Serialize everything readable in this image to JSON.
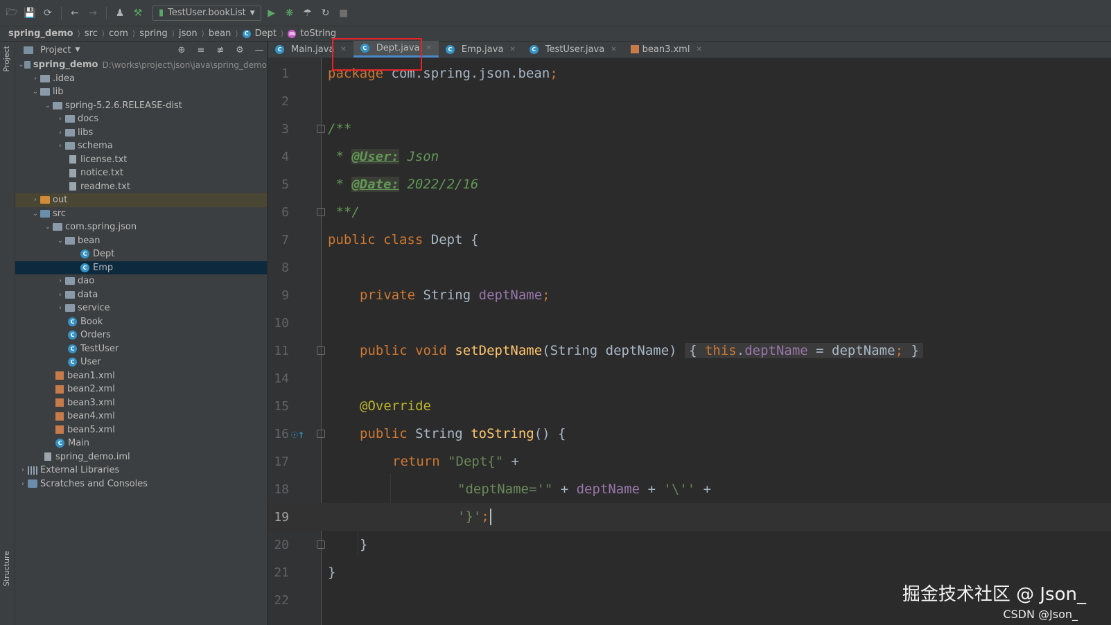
{
  "toolbar": {
    "run_config": "TestUser.bookList"
  },
  "breadcrumb": [
    "spring_demo",
    "src",
    "com",
    "spring",
    "json",
    "bean",
    "Dept",
    "toString"
  ],
  "side_stripe": {
    "project_label": "Project",
    "structure_label": "Structure"
  },
  "project_panel": {
    "title": "Project",
    "tree": [
      {
        "label": "spring_demo",
        "hint": "D:\\works\\project\\json\\java\\spring_demo"
      },
      {
        "label": ".idea"
      },
      {
        "label": "lib"
      },
      {
        "label": "spring-5.2.6.RELEASE-dist"
      },
      {
        "label": "docs"
      },
      {
        "label": "libs"
      },
      {
        "label": "schema"
      },
      {
        "label": "license.txt"
      },
      {
        "label": "notice.txt"
      },
      {
        "label": "readme.txt"
      },
      {
        "label": "out"
      },
      {
        "label": "src"
      },
      {
        "label": "com.spring.json"
      },
      {
        "label": "bean"
      },
      {
        "label": "Dept"
      },
      {
        "label": "Emp"
      },
      {
        "label": "dao"
      },
      {
        "label": "data"
      },
      {
        "label": "service"
      },
      {
        "label": "Book"
      },
      {
        "label": "Orders"
      },
      {
        "label": "TestUser"
      },
      {
        "label": "User"
      },
      {
        "label": "bean1.xml"
      },
      {
        "label": "bean2.xml"
      },
      {
        "label": "bean3.xml"
      },
      {
        "label": "bean4.xml"
      },
      {
        "label": "bean5.xml"
      },
      {
        "label": "Main"
      },
      {
        "label": "spring_demo.iml"
      },
      {
        "label": "External Libraries"
      },
      {
        "label": "Scratches and Consoles"
      }
    ]
  },
  "tabs": [
    {
      "label": "Main.java"
    },
    {
      "label": "Dept.java"
    },
    {
      "label": "Emp.java"
    },
    {
      "label": "TestUser.java"
    },
    {
      "label": "bean3.xml"
    }
  ],
  "editor": {
    "line_numbers": [
      "1",
      "2",
      "3",
      "4",
      "5",
      "6",
      "7",
      "8",
      "9",
      "10",
      "11",
      "14",
      "15",
      "16",
      "17",
      "18",
      "19",
      "20",
      "21",
      "22"
    ],
    "current_line": "19",
    "tokens": {
      "package_kw": "package",
      "package_name": "com.spring.json.bean",
      "semicolon": ";",
      "doc_open": "/**",
      "doc_star": " * ",
      "tag_user": "@User:",
      "user_val": " Json",
      "tag_date": "@Date:",
      "date_val": " 2022/2/16",
      "doc_close": " **/",
      "public": "public",
      "class": "class",
      "class_name": "Dept",
      "open_brace": "{",
      "close_brace": "}",
      "private": "private",
      "string_type": "String",
      "field": "deptName",
      "void": "void",
      "setter": "setDeptName",
      "setter_params": "(String deptName)",
      "this": "this",
      "eq": " = ",
      "param": "deptName",
      "annotation": "@Override",
      "tostring": "toString",
      "parens": "()",
      "return": "return",
      "str_open": "\"Dept{\"",
      "plus": " + ",
      "str_field": "\"deptName='\"",
      "str_quote": "'\\''",
      "str_close": "'}'"
    }
  },
  "watermark": {
    "main": "掘金技术社区 @ Json_",
    "sub": "CSDN @Json_"
  }
}
